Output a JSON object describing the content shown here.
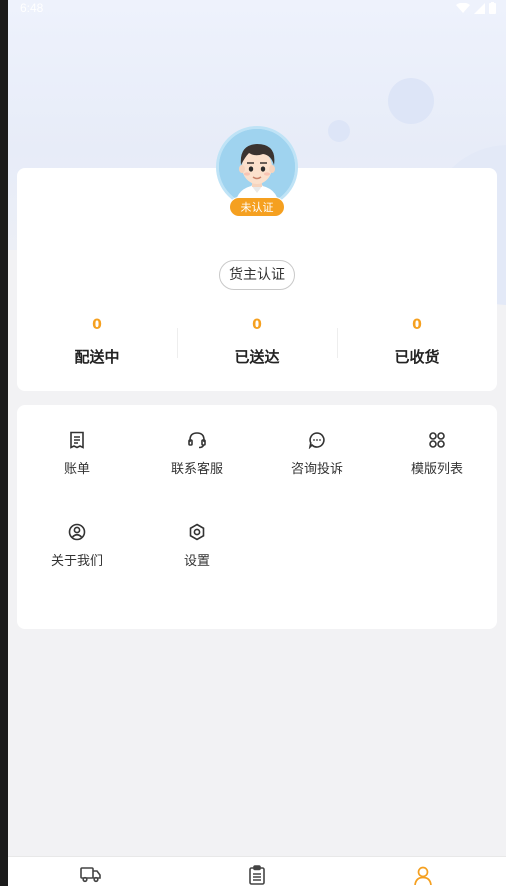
{
  "status_bar": {
    "time": "6:48"
  },
  "profile": {
    "badge": "未认证",
    "cert_button": "货主认证",
    "stats": [
      {
        "value": "0",
        "label": "配送中"
      },
      {
        "value": "0",
        "label": "已送达"
      },
      {
        "value": "0",
        "label": "已收货"
      }
    ]
  },
  "menu": {
    "items": [
      {
        "label": "账单",
        "icon": "bill-icon"
      },
      {
        "label": "联系客服",
        "icon": "headset-icon"
      },
      {
        "label": "咨询投诉",
        "icon": "chat-icon"
      },
      {
        "label": "模版列表",
        "icon": "grid-icon"
      },
      {
        "label": "关于我们",
        "icon": "user-circle-icon"
      },
      {
        "label": "设置",
        "icon": "settings-icon"
      }
    ]
  },
  "tabbar": {
    "tabs": [
      {
        "icon": "truck-icon",
        "active": false
      },
      {
        "icon": "clipboard-icon",
        "active": false
      },
      {
        "icon": "person-icon",
        "active": true
      }
    ]
  },
  "colors": {
    "accent": "#f5a020",
    "background": "#f2f2f4",
    "card": "#ffffff"
  }
}
